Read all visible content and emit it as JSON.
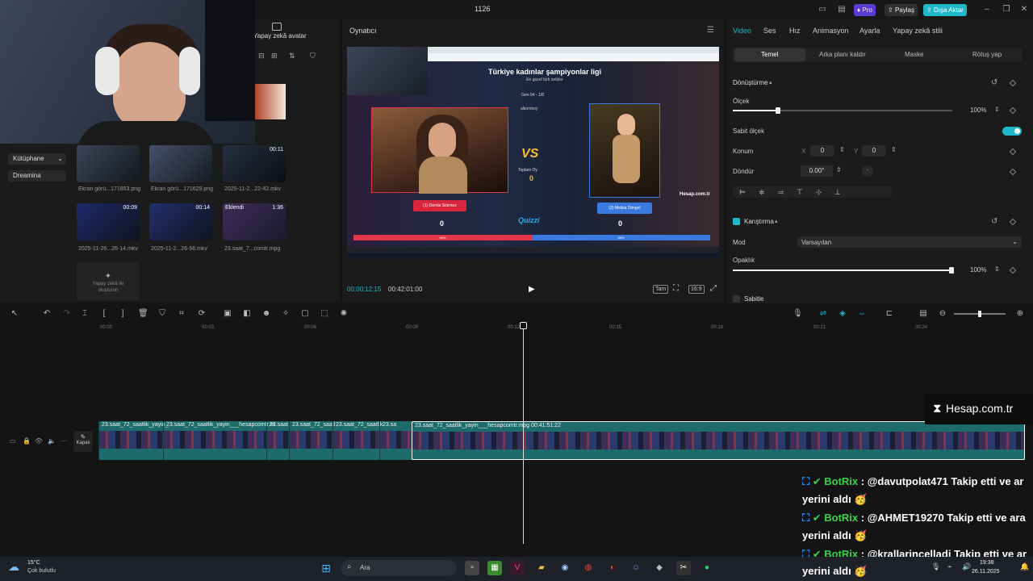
{
  "titlebar": {
    "title": "1126",
    "pro_label": "Pro",
    "share_label": "Paylaş",
    "export_label": "Dışa Aktar"
  },
  "media_panel": {
    "ai_avatar_label": "Yapay zekâ avatar",
    "nav": [
      "Kütüphane",
      "Dreamina"
    ],
    "thumbs": [
      {
        "caption": "Ekran görü...171853.png",
        "duration": "",
        "tag": ""
      },
      {
        "caption": "Ekran görü...171629.png",
        "duration": "",
        "tag": ""
      },
      {
        "caption": "2025-11-2...22-42.mkv",
        "duration": "00:11",
        "tag": ""
      },
      {
        "caption": "2025-11-26...26-14.mkv",
        "duration": "00:09",
        "tag": ""
      },
      {
        "caption": "2025-11-2...26-56.mkv",
        "duration": "00:14",
        "tag": ""
      },
      {
        "caption": "23.saat_7...comtr.mpg",
        "duration": "1:36",
        "tag": "Eklendi"
      }
    ],
    "ai_create_label": "Yapay zekâ ile oluşturun"
  },
  "player": {
    "title": "Oynatıcı",
    "current_time": "00:00:12:15",
    "total_time": "00:42:01:00",
    "full_label": "Tam",
    "ratio_label": "16:9"
  },
  "preview": {
    "heading": "Türkiye kadınlar şampiyonlar ligi",
    "subheading": "En güzel türk ünlüler",
    "round": "Gen 04 - 1/8",
    "user": "alkomboy",
    "total_label": "Toplam Oy",
    "total_value": "0",
    "left_name": "(1) Demla Sözmez",
    "right_name": "(2) Melisa Döngel",
    "left_score": "0",
    "right_score": "0",
    "left_pct": "50%",
    "right_pct": "50%",
    "brand": "Quizzi",
    "site": "Hesap.com.tr",
    "vs": "VS"
  },
  "props": {
    "tabs": [
      "Video",
      "Ses",
      "Hız",
      "Animasyon",
      "Ayarla",
      "Yapay zekâ stili"
    ],
    "subtabs": [
      "Temel",
      "Arka planı kaldır",
      "Maske",
      "Rötuş yap"
    ],
    "transform_label": "Dönüştürme",
    "scale_label": "Ölçek",
    "scale_value": "100%",
    "uniform_label": "Sabit ölçek",
    "position_label": "Konum",
    "x_label": "X",
    "x_value": "0",
    "y_label": "Y",
    "y_value": "0",
    "rotate_label": "Döndür",
    "rotate_value": "0.00°",
    "blend_label": "Karıştırma",
    "mode_label": "Mod",
    "mode_value": "Varsayılan",
    "opacity_label": "Opaklık",
    "opacity_value": "100%",
    "stabilize_label": "Sabitle"
  },
  "timeline": {
    "ticks": [
      "00:00",
      "00:03",
      "00:06",
      "00:09",
      "00:12",
      "00:15",
      "00:18",
      "00:21",
      "00:24"
    ],
    "cover_label": "Kapak",
    "clips": [
      {
        "label": "23.saat_72_saatlik_yayin_"
      },
      {
        "label": "23.saat_72_saatlik_yayin___hesapcomtr.m"
      },
      {
        "label": "23.saat"
      },
      {
        "label": "23.saat_72_saatl"
      },
      {
        "label": "23.saat_72_saatlik"
      },
      {
        "label": "23.sa"
      },
      {
        "label": "23.saat_72_saatlik_yayin___hesapcomtr.mpg   00:41:51:22"
      }
    ]
  },
  "overlay": {
    "brand": "Hesap.com.tr",
    "chat": [
      {
        "user": "BotRix",
        "text": " : @davutpolat471 Takip etti ve ar",
        "line2": "yerini aldı 🥳"
      },
      {
        "user": "BotRix",
        "text": " : @AHMET19270 Takip etti ve ara",
        "line2": "yerini aldı 🥳"
      },
      {
        "user": "BotRix",
        "text": " : @krallarincelladi Takip etti ve ar",
        "line2": "yerini aldı 🥳"
      }
    ]
  },
  "taskbar": {
    "temp": "15°C",
    "weather": "Çok bulutlu",
    "search": "Ara",
    "time": "19:38",
    "date": "26.11.2025"
  }
}
